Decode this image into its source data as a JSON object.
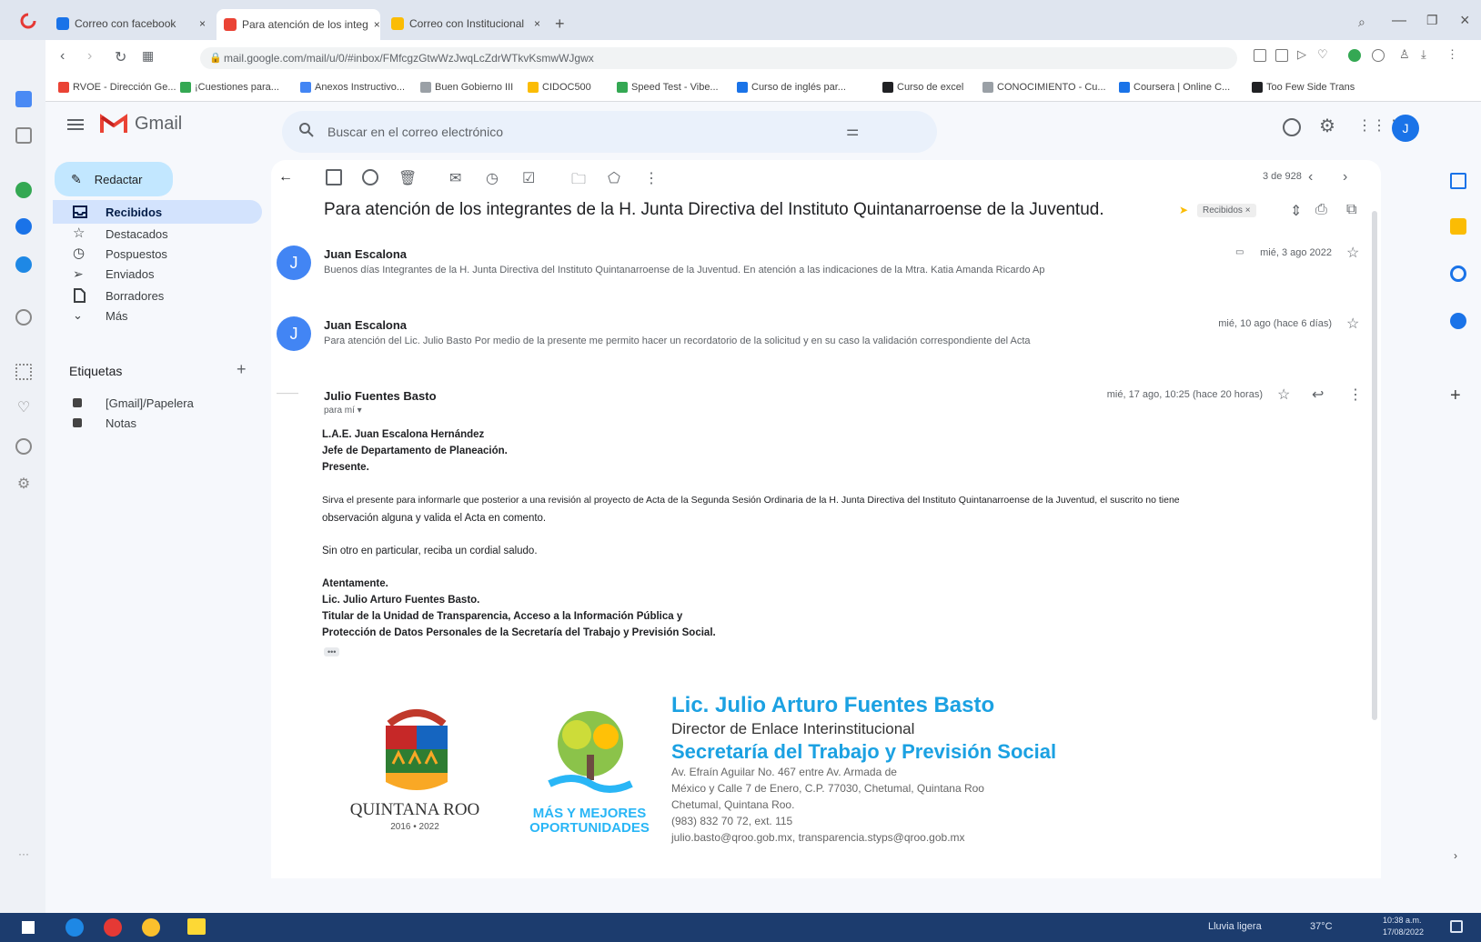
{
  "browser": {
    "tabs": [
      {
        "label": "Correo con facebook",
        "color": "#1a73e8"
      },
      {
        "label": "Para atención de los integ",
        "color": "#ea4335",
        "active": true
      },
      {
        "label": "Correo con Institucional",
        "color": "#fbbc04"
      }
    ],
    "url": "mail.google.com/mail/u/0/#inbox/FMfcgzGtwWzJwqLcZdrWTkvKsmwWJgwx",
    "bookmarks": [
      {
        "label": "RVOE - Dirección Ge...",
        "color": "#ea4335"
      },
      {
        "label": "¡Cuestiones para...",
        "color": "#34a853"
      },
      {
        "label": "Anexos Instructivo...",
        "color": "#4285f4"
      },
      {
        "label": "Buen Gobierno III",
        "color": "#9aa0a6"
      },
      {
        "label": "CIDOC500",
        "color": "#fbbc04"
      },
      {
        "label": "Speed Test - Vibe...",
        "color": "#34a853"
      },
      {
        "label": "Curso de inglés par...",
        "color": "#1a73e8"
      },
      {
        "label": "Curso de excel",
        "color": "#202124"
      },
      {
        "label": "CONOCIMIENTO - Cu...",
        "color": "#9aa0a6"
      },
      {
        "label": "Coursera | Online C...",
        "color": "#1a73e8"
      },
      {
        "label": "Too Few Side Trans",
        "color": "#202124"
      }
    ]
  },
  "gmail": {
    "logo_text": "Gmail",
    "search_placeholder": "Buscar en el correo electrónico",
    "compose_label": "Redactar",
    "nav": [
      {
        "label": "Recibidos",
        "icon": "inbox-icon",
        "active": true
      },
      {
        "label": "Destacados",
        "icon": "star-icon"
      },
      {
        "label": "Pospuestos",
        "icon": "clock-icon"
      },
      {
        "label": "Enviados",
        "icon": "send-icon"
      },
      {
        "label": "Borradores",
        "icon": "draft-icon"
      },
      {
        "label": "Más",
        "icon": "chevron-down-icon"
      }
    ],
    "labels_title": "Etiquetas",
    "labels": [
      {
        "label": "[Gmail]/Papelera"
      },
      {
        "label": "Notas"
      }
    ],
    "pagination": "3 de 928"
  },
  "thread": {
    "subject": "Para atención de los integrantes de la H. Junta Directiva del Instituto Quintanarroense de la Juventud.",
    "inbox_badge": "Recibidos ×",
    "messages": [
      {
        "avatar": "J",
        "sender": "Juan Escalona",
        "snippet": "Buenos días Integrantes de la H. Junta Directiva del Instituto Quintanarroense de la Juventud. En atención a las indicaciones de la Mtra. Katia Amanda Ricardo Ap",
        "date": "mié, 3 ago 2022"
      },
      {
        "avatar": "J",
        "sender": "Juan Escalona",
        "snippet": "Para atención del Lic. Julio Basto Por medio de la presente me permito hacer un recordatorio de la solicitud y en su caso la validación correspondiente del Acta",
        "date": "mié, 10 ago (hace 6 días)"
      }
    ],
    "open_message": {
      "sender": "Julio Fuentes Basto",
      "to": "para mí ▾",
      "date": "mié, 17 ago, 10:25 (hace 20 horas)",
      "lines": [
        {
          "text": "L.A.E. Juan Escalona Hernández",
          "bold": true
        },
        {
          "text": "Jefe de Departamento de Planeación.",
          "bold": true
        },
        {
          "text": "Presente.",
          "bold": true
        },
        {
          "text": "Sirva el presente para informarle que posterior a una revisión al proyecto de Acta de la Segunda Sesión Ordinaria de la H. Junta Directiva del Instituto Quintanarroense de la Juventud, el suscrito no tiene",
          "bold": false
        },
        {
          "text": "observación alguna y valida el Acta en comento.",
          "bold": false
        },
        {
          "text": "Sin otro en particular, reciba un cordial saludo.",
          "bold": false
        },
        {
          "text": "Atentamente.",
          "bold": true
        },
        {
          "text": "Lic. Julio Arturo Fuentes Basto.",
          "bold": true
        },
        {
          "text": "Titular de la Unidad de Transparencia, Acceso a la Información Pública y",
          "bold": true
        },
        {
          "text": "Protección de Datos Personales de la Secretaría del Trabajo y Previsión Social.",
          "bold": true
        }
      ],
      "ellipsis": "•••"
    },
    "signature": {
      "name": "Lic. Julio Arturo Fuentes Basto",
      "role": "Director de Enlace Interinstitucional",
      "org": "Secretaría del Trabajo y Previsión Social",
      "address1": "Av. Efraín Aguilar No. 467 entre Av. Armada de",
      "address2": "México y Calle 7 de Enero, C.P. 77030, Chetumal, Quintana Roo",
      "address3": "Chetumal, Quintana Roo.",
      "phone": "(983) 832 70 72, ext. 115",
      "emails": "julio.basto@qroo.gob.mx, transparencia.styps@qroo.gob.mx",
      "logo1_text": "QUINTANA ROO",
      "logo1_sub": "2016 • 2022",
      "logo2_line1": "MÁS Y MEJORES",
      "logo2_line2": "OPORTUNIDADES"
    }
  },
  "taskbar": {
    "weather": "Lluvia ligera",
    "temp": "37°C",
    "time": "10:38 a.m.",
    "date": "17/08/2022"
  },
  "colors": {
    "accent": "#1a73e8",
    "sig_blue": "#1ba1e2",
    "sig_dark": "#333333",
    "gmail_red": "#ea4335"
  }
}
